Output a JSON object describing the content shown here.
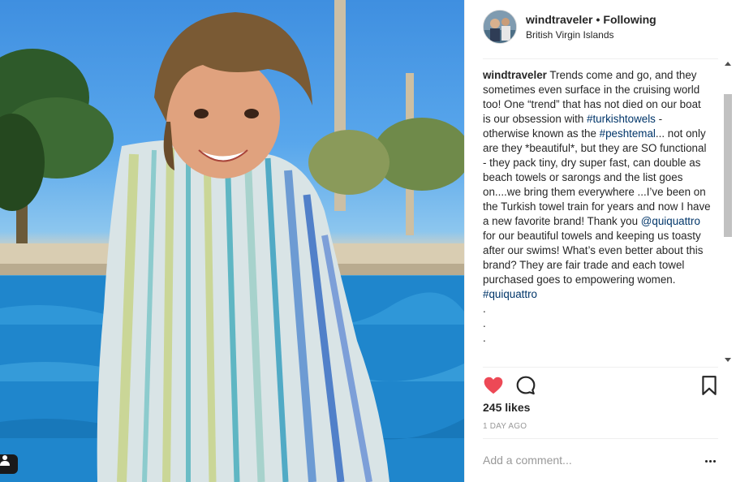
{
  "post": {
    "username": "windtraveler",
    "separator": "•",
    "follow_label": "Following",
    "location": "British Virgin Islands",
    "image_alt": "Child wrapped in striped turkish towel by a pool",
    "caption": {
      "username": "windtraveler",
      "t1": " Trends come and go, and they sometimes even surface in the cruising world too! One “trend” that has not died on our boat is our obsession with ",
      "tag1": "#turkishtowels",
      "t2": " - otherwise known as the ",
      "tag2": "#peshtemal",
      "t3": "... not only are they *beautiful*, but they are SO functional - they pack tiny, dry super fast, can double as beach towels or sarongs and the list goes on....we bring them everywhere ...I’ve been on the Turkish towel train for years and now I have a new favorite brand! Thank you ",
      "mention": "@quiquattro",
      "t4": " for our beautiful towels and keeping us toasty after our swims! What’s even better about this brand? They are fair trade and each towel purchased goes to empowering women. ",
      "tag3": "#quiquattro",
      "dots": [
        ".",
        ".",
        "."
      ]
    },
    "likes": "245 likes",
    "time": "1 DAY AGO",
    "comment_placeholder": "Add a comment...",
    "liked": true
  },
  "icons": {
    "like": "heart-filled-icon",
    "comment": "speech-bubble-icon",
    "save": "bookmark-icon",
    "more": "ellipsis-icon",
    "user_tag": "person-tag-icon"
  },
  "colors": {
    "like": "#ed4956",
    "link": "#003569",
    "text": "#262626",
    "muted": "#999999"
  }
}
